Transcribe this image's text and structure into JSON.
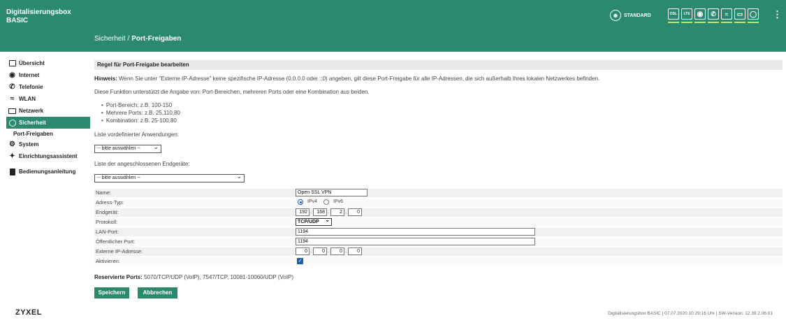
{
  "header": {
    "brand_line1": "Digitalisierungsbox",
    "brand_line2": "BASIC",
    "mode_label": "STANDARD",
    "breadcrumb": {
      "parent": "Sicherheit",
      "separator": "/",
      "current": "Port-Freigaben"
    },
    "status_icons": [
      {
        "icon": "dsl-icon",
        "label": "DSL"
      },
      {
        "icon": "lte-icon",
        "label": "LTE"
      },
      {
        "icon": "globe-icon",
        "label": ""
      },
      {
        "icon": "phone-icon",
        "label": ""
      },
      {
        "icon": "wifi-icon",
        "label": ""
      },
      {
        "icon": "lan-icon",
        "label": ""
      },
      {
        "icon": "shield-icon",
        "label": ""
      }
    ],
    "status_bar_color": "#c6e36a",
    "accent_color": "#2b8a6e"
  },
  "sidebar": {
    "items": [
      {
        "icon": "home-icon",
        "label": "Übersicht"
      },
      {
        "icon": "globe-icon",
        "label": "Internet"
      },
      {
        "icon": "phone-icon",
        "label": "Telefonie"
      },
      {
        "icon": "wifi-icon",
        "label": "WLAN"
      },
      {
        "icon": "network-icon",
        "label": "Netzwerk"
      },
      {
        "icon": "shield-icon",
        "label": "Sicherheit",
        "active": true
      },
      {
        "icon": "gear-icon",
        "label": "System"
      },
      {
        "icon": "wand-icon",
        "label": "Einrichtungsassistent"
      },
      {
        "icon": "book-icon",
        "label": "Bedienungsanleitung"
      }
    ],
    "subitem": "Port-Freigaben"
  },
  "main": {
    "section_title": "Regel für Port-Freigabe bearbeiten",
    "hint_label": "Hinweis:",
    "hint_text": "Wenn Sie unter \"Externe IP-Adresse\" keine spezifische IP-Adresse (0.0.0.0 oder ::0) angeben, gilt diese Port-Freigabe für alle IP-Adressen, die sich außerhalb Ihres lokalen Netzwerkes befinden.",
    "support_text": "Diese Funktion unterstützt die Angabe von: Port-Bereichen, mehreren Ports oder eine Kombination aus beiden.",
    "examples": [
      "Port-Bereich: z.B. 100-150",
      "Mehrere Ports: z.B. 25,110,80",
      "Kombination: z.B. 25-100,80"
    ],
    "predefined_label": "Liste vordefinierter Anwendungen:",
    "predefined_value": "-- bitte auswählen --",
    "devices_label": "Liste der angeschlossenen Endgeräte:",
    "devices_value": "-- bitte auswählen --",
    "form": {
      "name_label": "Name:",
      "name_value": "Open SSL VPN",
      "addrtype_label": "Adress-Typ:",
      "ipv4_label": "IPv4",
      "ipv6_label": "IPv6",
      "device_label": "Endgerät:",
      "device_octets": [
        "192",
        "168",
        "2",
        "0"
      ],
      "protocol_label": "Protokoll:",
      "protocol_value": "TCP/UDP",
      "lan_port_label": "LAN-Port:",
      "lan_port_value": "1194",
      "public_port_label": "Öffentlicher Port:",
      "public_port_value": "1194",
      "ext_ip_label": "Externe IP-Adresse:",
      "ext_ip_octets": [
        "0",
        "0",
        "0",
        "0"
      ],
      "activate_label": "Aktivieren:",
      "activated": true
    },
    "reserved_label": "Reservierte Ports:",
    "reserved_text": "5070/TCP/UDP (VoIP), 7547/TCP, 10081-10060/UDP (VoIP)",
    "save_label": "Speichern",
    "cancel_label": "Abbrechen"
  },
  "footer": {
    "logo": "ZYXEL",
    "status": "Digitalisierungsbox BASIC | 07.07.2020 10:29:16 Uhr | SW-Version: 12.39.2.06.01"
  }
}
